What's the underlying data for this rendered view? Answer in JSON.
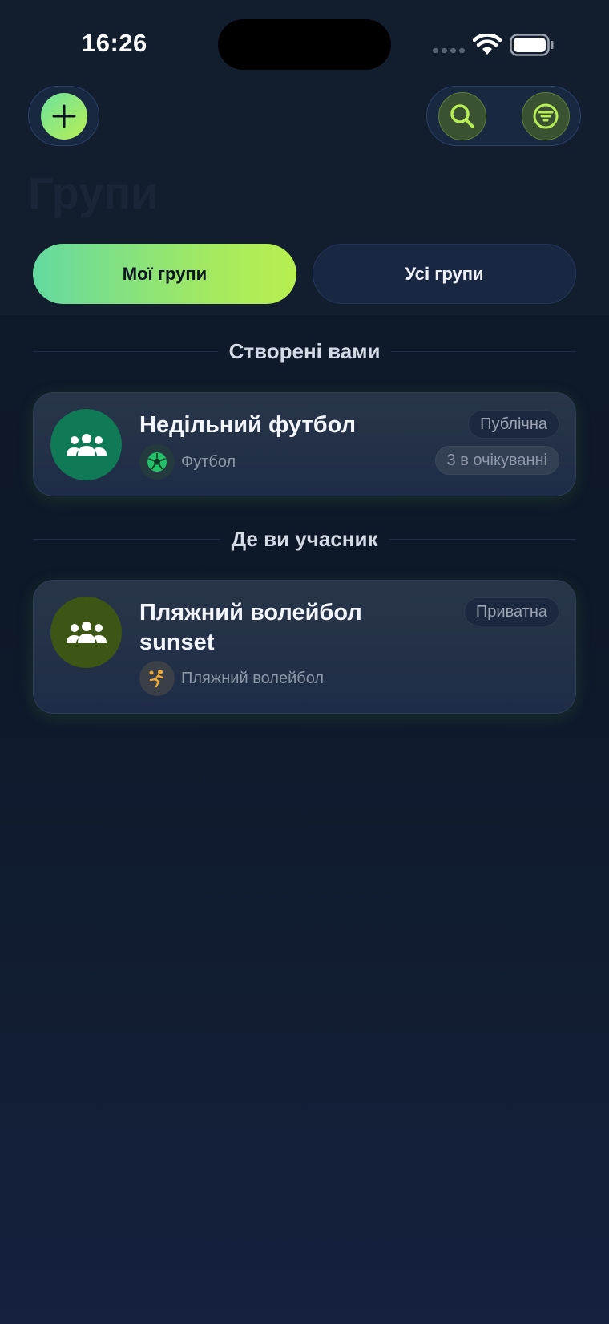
{
  "status_bar": {
    "time": "16:26"
  },
  "header": {
    "title": "Групи",
    "add_icon": "plus-icon",
    "search_icon": "search-icon",
    "filter_icon": "filter-icon"
  },
  "tabs": [
    {
      "label": "Мої групи",
      "active": true
    },
    {
      "label": "Усі групи",
      "active": false
    }
  ],
  "sections": {
    "created": {
      "title": "Створені вами",
      "groups": [
        {
          "name": "Недільний футбол",
          "sport": "Футбол",
          "sport_icon": "soccer-ball-icon",
          "visibility": "Публічна",
          "pending": "3 в очікуванні",
          "avatar_color": "#0f7a55"
        }
      ]
    },
    "member": {
      "title": "Де ви учасник",
      "groups": [
        {
          "name": "Пляжний волейбол sunset",
          "sport": "Пляжний волейбол",
          "sport_icon": "volleyball-player-icon",
          "visibility": "Приватна",
          "avatar_color": "#3d5615"
        }
      ]
    }
  },
  "colors": {
    "accent_start": "#63d9a0",
    "accent_end": "#b8ef4f",
    "background": "#0f1a2b"
  }
}
